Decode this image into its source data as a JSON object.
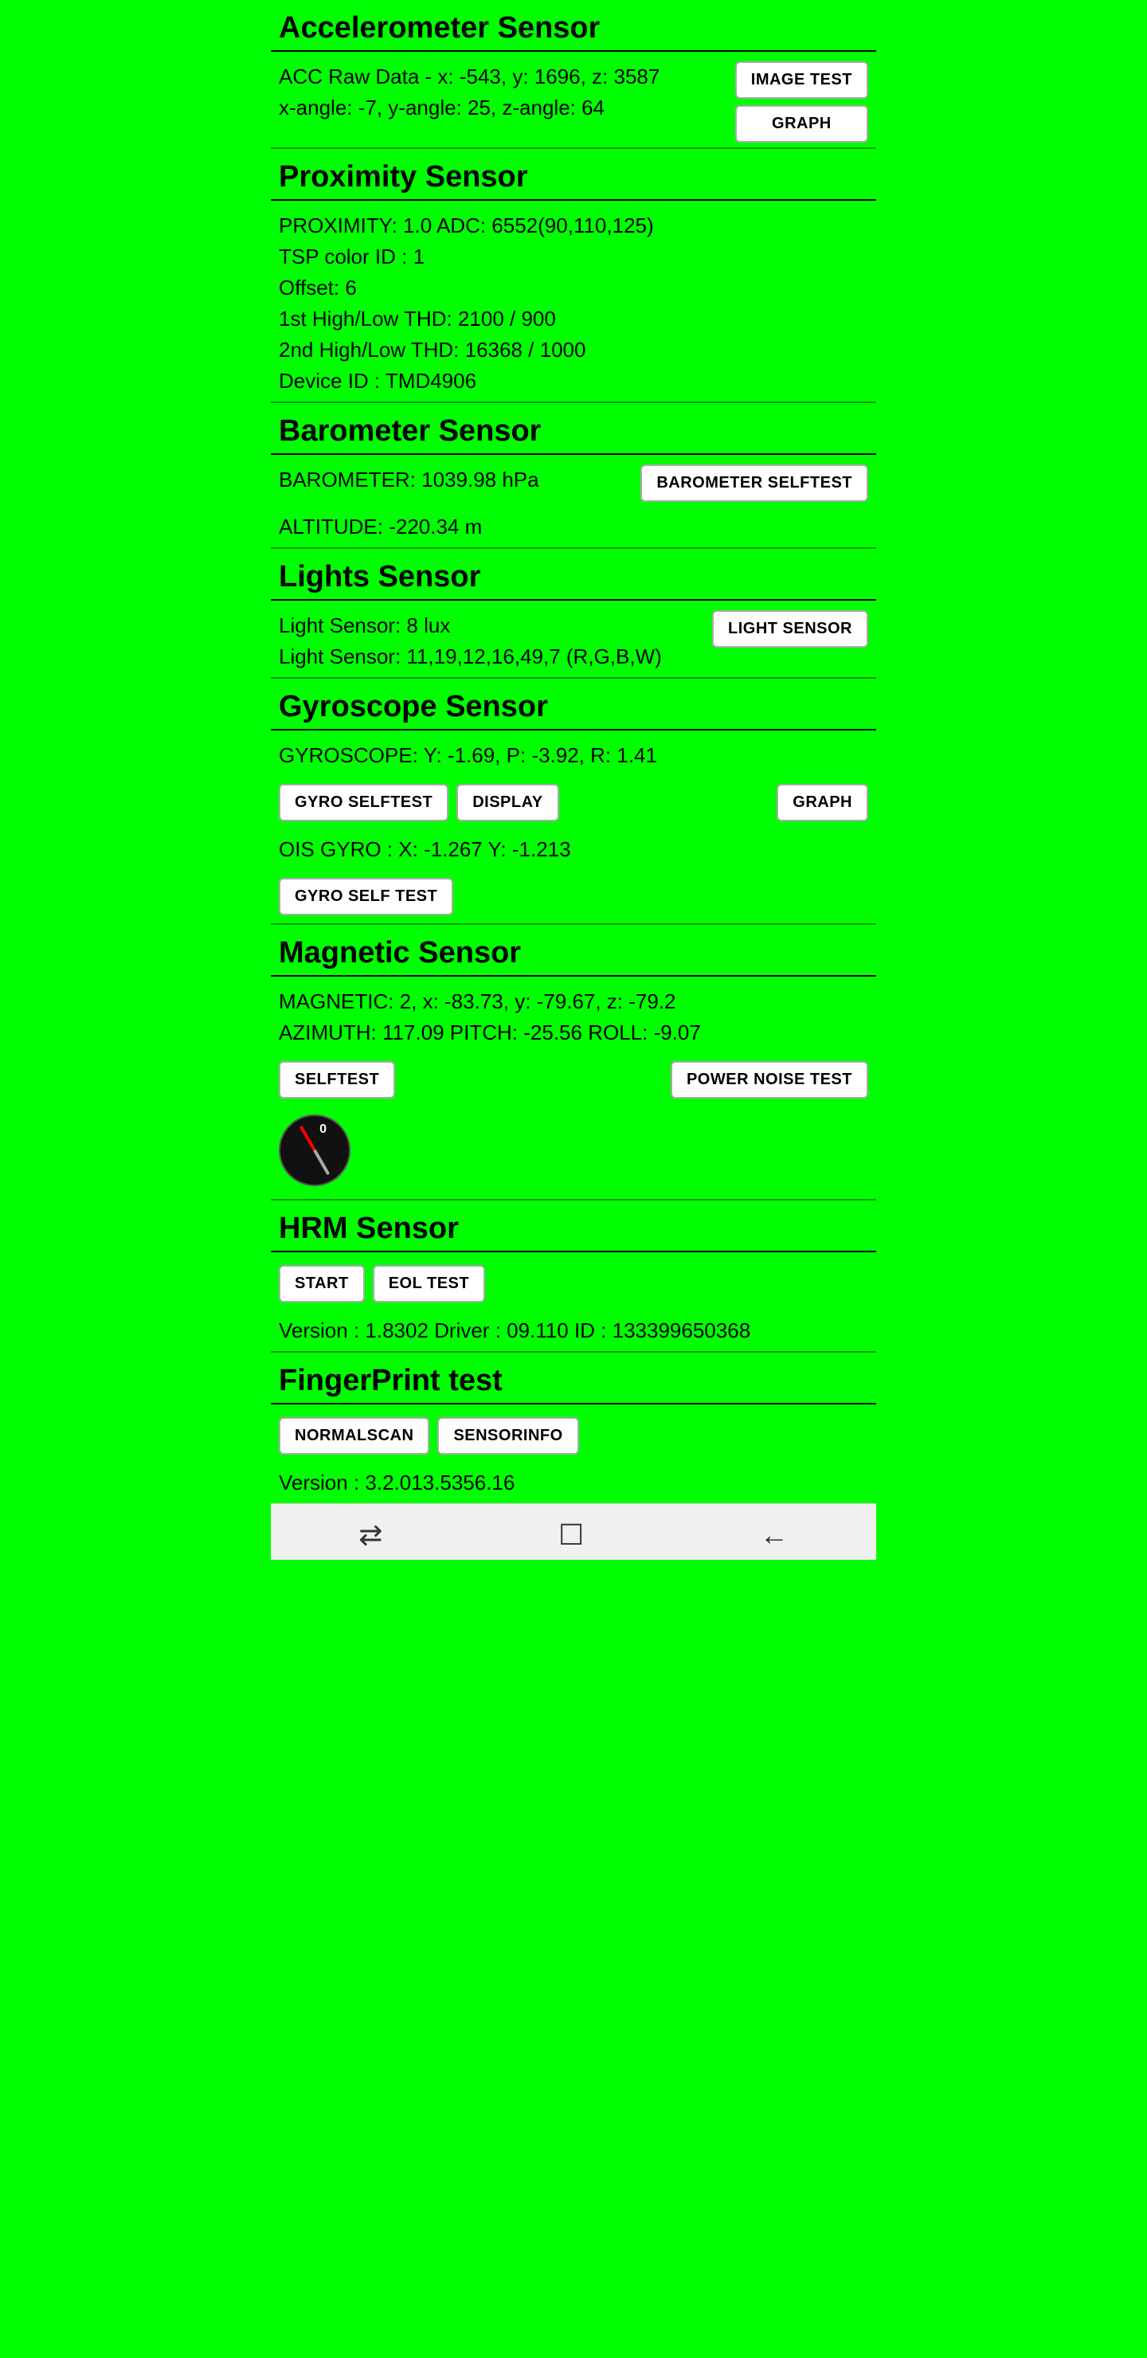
{
  "accelerometer": {
    "title": "Accelerometer Sensor",
    "line1": "ACC Raw Data - x: -543, y: 1696, z: 3587",
    "line2": "x-angle: -7, y-angle: 25, z-angle: 64",
    "btn_image": "IMAGE TEST",
    "btn_graph": "GRAPH"
  },
  "proximity": {
    "title": "Proximity Sensor",
    "line1": "PROXIMITY: 1.0    ADC: 6552(90,110,125)",
    "line2": "TSP color ID : 1",
    "line3": "Offset: 6",
    "line4": "1st High/Low THD: 2100 / 900",
    "line5": "2nd High/Low THD: 16368 / 1000",
    "line6": "Device ID : TMD4906"
  },
  "barometer": {
    "title": "Barometer Sensor",
    "line1": "BAROMETER: 1039.98 hPa",
    "line2": "ALTITUDE: -220.34 m",
    "btn_selftest": "BAROMETER SELFTEST"
  },
  "lights": {
    "title": "Lights Sensor",
    "line1": "Light Sensor: 8 lux",
    "line2": "Light Sensor: 11,19,12,16,49,7 (R,G,B,W)",
    "btn_light": "LIGHT SENSOR"
  },
  "gyroscope": {
    "title": "Gyroscope Sensor",
    "line1": "GYROSCOPE: Y: -1.69, P: -3.92, R: 1.41",
    "btn_selftest": "GYRO SELFTEST",
    "btn_display": "DISPLAY",
    "btn_graph": "GRAPH",
    "line2": "OIS GYRO : X: -1.267 Y: -1.213",
    "btn_gyro_self_test": "GYRO SELF TEST"
  },
  "magnetic": {
    "title": "Magnetic Sensor",
    "line1": "MAGNETIC: 2, x: -83.73, y: -79.67, z: -79.2",
    "line2": "AZIMUTH: 117.09  PITCH: -25.56  ROLL: -9.07",
    "btn_selftest": "SELFTEST",
    "btn_power_noise": "POWER NOISE TEST"
  },
  "hrm": {
    "title": "HRM Sensor",
    "btn_start": "START",
    "btn_eol": "EOL TEST",
    "version_line": "Version : 1.8302  Driver : 09.110  ID : 133399650368"
  },
  "fingerprint": {
    "title": "FingerPrint test",
    "btn_normalscan": "NORMALSCAN",
    "btn_sensorinfo": "SENSORINFO",
    "version_line": "Version : 3.2.013.5356.16"
  },
  "navbar": {
    "icon_back_label": "back",
    "icon_home_label": "home",
    "icon_recent_label": "recent"
  }
}
